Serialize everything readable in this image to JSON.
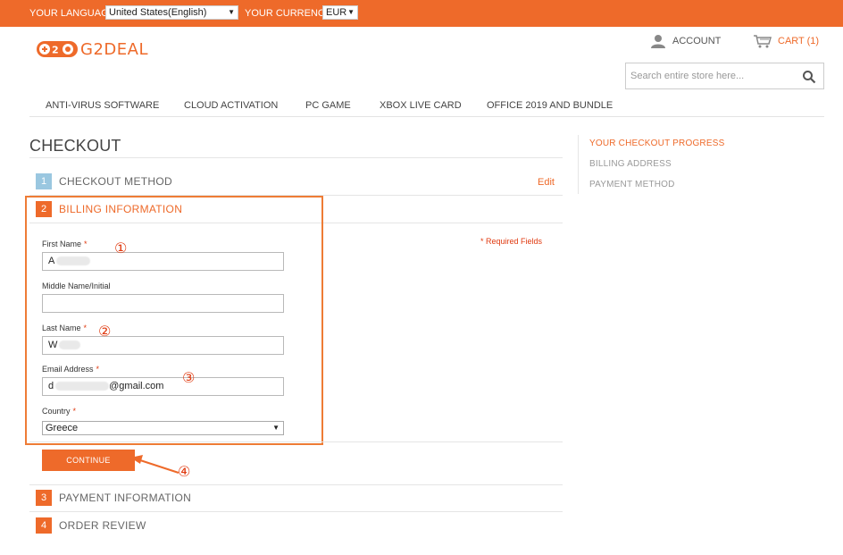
{
  "topbar": {
    "language_label": "YOUR LANGUAGE:",
    "language_value": "United States(English)",
    "currency_label": "YOUR CURRENCY:",
    "currency_value": "EUR"
  },
  "logo": {
    "text": "G2DEAL"
  },
  "header": {
    "account_label": "ACCOUNT",
    "cart_label": "CART (1)"
  },
  "search": {
    "placeholder": "Search entire store here..."
  },
  "nav": {
    "items": [
      "ANTI-VIRUS SOFTWARE",
      "CLOUD ACTIVATION",
      "PC GAME",
      "XBOX LIVE CARD",
      "OFFICE 2019 AND BUNDLE"
    ]
  },
  "checkout": {
    "title": "CHECKOUT",
    "steps": [
      {
        "num": "1",
        "title": "CHECKOUT METHOD"
      },
      {
        "num": "2",
        "title": "BILLING INFORMATION"
      },
      {
        "num": "3",
        "title": "PAYMENT INFORMATION"
      },
      {
        "num": "4",
        "title": "ORDER REVIEW"
      }
    ],
    "edit_label": "Edit",
    "required_note": "* Required Fields",
    "continue_label": "CONTINUE"
  },
  "form": {
    "first_name_label": "First Name",
    "first_name_value": "A",
    "middle_name_label": "Middle Name/Initial",
    "middle_name_value": "",
    "last_name_label": "Last Name",
    "last_name_value": "W",
    "email_label": "Email Address",
    "email_value_start": "d",
    "email_value_end": "@gmail.com",
    "country_label": "Country",
    "country_value": "Greece",
    "required_mark": "*"
  },
  "annotations": {
    "a1": "①",
    "a2": "②",
    "a3": "③",
    "a4": "④"
  },
  "sidebar": {
    "title": "YOUR CHECKOUT PROGRESS",
    "items": [
      "BILLING ADDRESS",
      "PAYMENT METHOD"
    ]
  },
  "colors": {
    "accent": "#ee6a2a",
    "step_done": "#9ac7e0",
    "required": "#e03a10"
  }
}
